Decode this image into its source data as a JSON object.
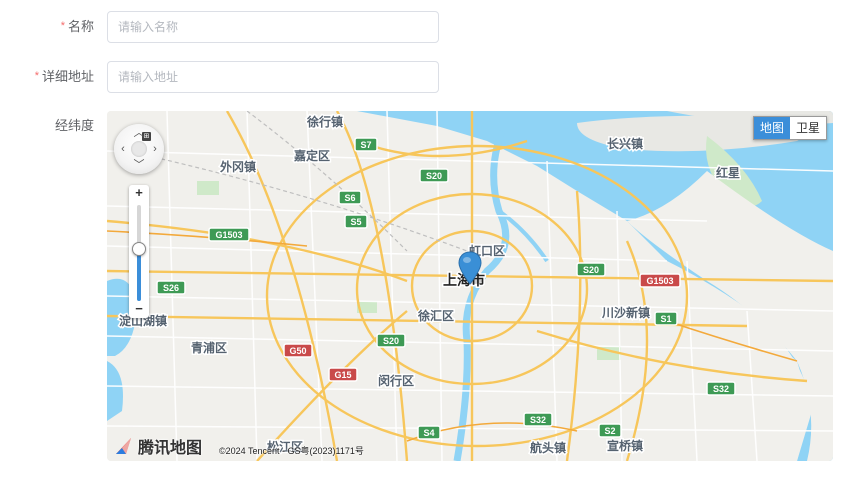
{
  "form": {
    "name": {
      "label": "名称",
      "required": "*",
      "placeholder": "请输入名称",
      "value": ""
    },
    "address": {
      "label": "详细地址",
      "required": "*",
      "placeholder": "请输入地址",
      "value": ""
    },
    "coords": {
      "label": "经纬度"
    }
  },
  "map": {
    "type_buttons": {
      "map": "地图",
      "satellite": "卫星",
      "active": "map"
    },
    "logo_text": "腾讯地图",
    "copyright": "©2024 Tencent - GS粤(2023)1171号",
    "zoom_level": 0.45,
    "districts": [
      {
        "name": "徐行镇"
      },
      {
        "name": "嘉定区"
      },
      {
        "name": "外冈镇"
      },
      {
        "name": "长兴镇"
      },
      {
        "name": "红星"
      },
      {
        "name": "虹口区"
      },
      {
        "name": "上海市"
      },
      {
        "name": "徐汇区"
      },
      {
        "name": "川沙新镇"
      },
      {
        "name": "青浦区"
      },
      {
        "name": "淀山湖镇"
      },
      {
        "name": "闵行区"
      },
      {
        "name": "松江区"
      },
      {
        "name": "航头镇"
      },
      {
        "name": "宣桥镇"
      }
    ],
    "shields": [
      {
        "label": "S7",
        "color": "#3e9a55"
      },
      {
        "label": "S20",
        "color": "#3e9a55"
      },
      {
        "label": "S6",
        "color": "#3e9a55"
      },
      {
        "label": "S5",
        "color": "#3e9a55"
      },
      {
        "label": "G1503",
        "color": "#3e9a55"
      },
      {
        "label": "S26",
        "color": "#3e9a55"
      },
      {
        "label": "S20",
        "color": "#3e9a55"
      },
      {
        "label": "G1503",
        "color": "#c94a4a"
      },
      {
        "label": "S1",
        "color": "#3e9a55"
      },
      {
        "label": "G50",
        "color": "#c94a4a"
      },
      {
        "label": "S20",
        "color": "#3e9a55"
      },
      {
        "label": "G15",
        "color": "#c94a4a"
      },
      {
        "label": "S32",
        "color": "#3e9a55"
      },
      {
        "label": "S4",
        "color": "#3e9a55"
      },
      {
        "label": "S32",
        "color": "#3e9a55"
      },
      {
        "label": "S2",
        "color": "#3e9a55"
      }
    ]
  }
}
